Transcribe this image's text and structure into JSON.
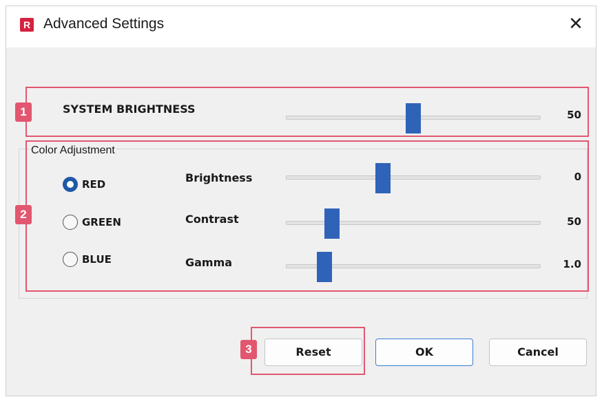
{
  "window": {
    "icon_letter": "R",
    "title": "Advanced Settings",
    "close_glyph": "✕"
  },
  "system_brightness": {
    "label": "SYSTEM BRIGHTNESS",
    "value": "50",
    "slider_fraction": 0.5
  },
  "color_adjustment": {
    "title": "Color Adjustment",
    "channels": [
      {
        "label": "RED",
        "checked": true
      },
      {
        "label": "GREEN",
        "checked": false
      },
      {
        "label": "BLUE",
        "checked": false
      }
    ],
    "controls": [
      {
        "label": "Brightness",
        "value": "0",
        "slider_fraction": 0.38
      },
      {
        "label": "Contrast",
        "value": "50",
        "slider_fraction": 0.18
      },
      {
        "label": "Gamma",
        "value": "1.0",
        "slider_fraction": 0.15
      }
    ]
  },
  "buttons": {
    "reset": "Reset",
    "ok": "OK",
    "cancel": "Cancel"
  },
  "callouts": {
    "one": "1",
    "two": "2",
    "three": "3"
  },
  "colors": {
    "accent": "#2f63b8",
    "callout": "#e2566f",
    "app_icon": "#d6213f"
  }
}
